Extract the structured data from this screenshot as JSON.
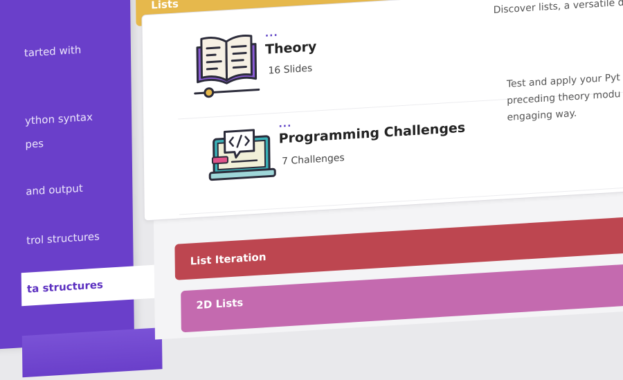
{
  "sidebar": {
    "items": [
      {
        "label": "tarted with"
      },
      {
        "label": "ython syntax"
      },
      {
        "label": "pes"
      },
      {
        "label": "and output"
      },
      {
        "label": "trol structures"
      },
      {
        "label": "ta structures"
      }
    ]
  },
  "sections": {
    "lists": {
      "header": "Lists",
      "rows": [
        {
          "dots": "...",
          "title": "Theory",
          "count": "16 Slides",
          "desc_lines": [
            "Discover lists, a versatile d"
          ]
        },
        {
          "dots": "...",
          "title": "Programming Challenges",
          "count": "7 Challenges",
          "desc_lines": [
            "Test and apply your Pyt",
            "preceding theory modu",
            "engaging way."
          ]
        }
      ]
    },
    "list_iteration": {
      "header": "List Iteration"
    },
    "lists_2d": {
      "header": "2D Lists"
    }
  },
  "icons": {
    "theory": "open-book-icon",
    "challenges": "laptop-code-icon"
  },
  "colors": {
    "sidebar": "#6a3fca",
    "lists": "#e6b84c",
    "list_iteration": "#bd4650",
    "lists_2d": "#c46aaf"
  }
}
